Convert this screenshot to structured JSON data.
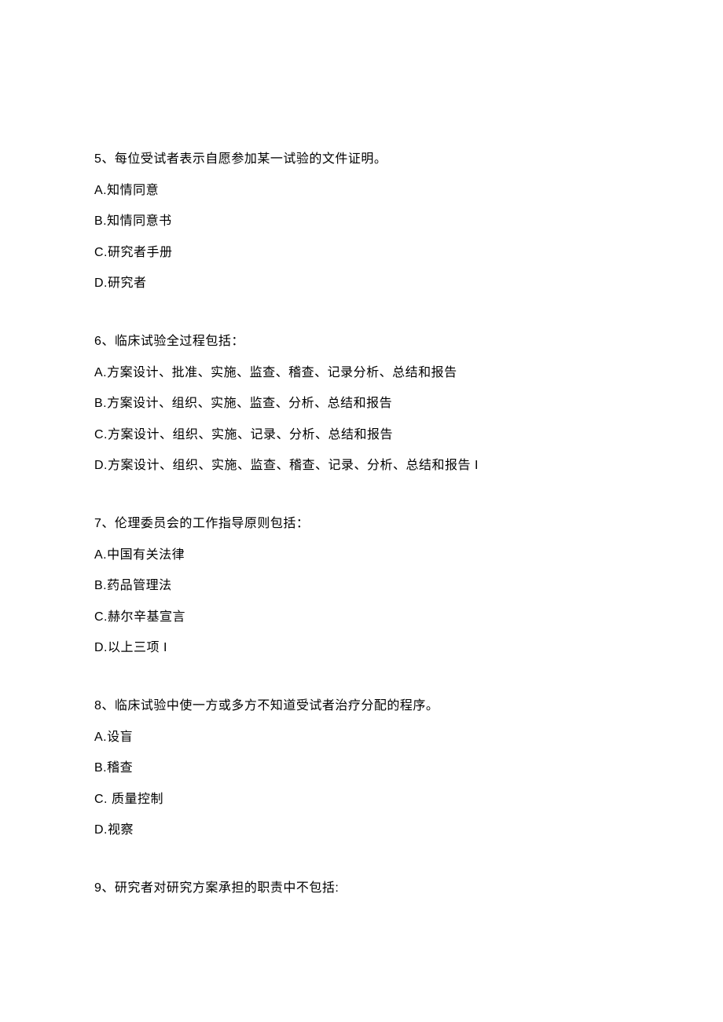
{
  "questions": [
    {
      "number": "5",
      "stem": "5、每位受试者表示自愿参加某一试验的文件证明。",
      "options": [
        {
          "label": "A.知情同意"
        },
        {
          "label": "B.知情同意书"
        },
        {
          "label": "C.研究者手册"
        },
        {
          "label": "D.研究者"
        }
      ]
    },
    {
      "number": "6",
      "stem": "6、临床试验全过程包括：",
      "options": [
        {
          "label": "A.方案设计、批准、实施、监查、稽查、记录分析、总结和报告"
        },
        {
          "label": "B.方案设计、组织、实施、监查、分析、总结和报告"
        },
        {
          "label": "C.方案设计、组织、实施、记录、分析、总结和报告"
        },
        {
          "label": "D.方案设计、组织、实施、监查、稽查、记录、分析、总结和报告 I"
        }
      ]
    },
    {
      "number": "7",
      "stem": "7、伦理委员会的工作指导原则包括：",
      "options": [
        {
          "label": "A.中国有关法律"
        },
        {
          "label": "B.药品管理法"
        },
        {
          "label": "C.赫尔辛基宣言"
        },
        {
          "label": "D.以上三项 I"
        }
      ]
    },
    {
      "number": "8",
      "stem": "8、临床试验中使一方或多方不知道受试者治疗分配的程序。",
      "options": [
        {
          "label": "A.设盲"
        },
        {
          "label": "B.稽查"
        },
        {
          "label": "C. 质量控制"
        },
        {
          "label": "D.视察"
        }
      ]
    },
    {
      "number": "9",
      "stem": "9、研究者对研究方案承担的职责中不包括:",
      "options": []
    }
  ]
}
